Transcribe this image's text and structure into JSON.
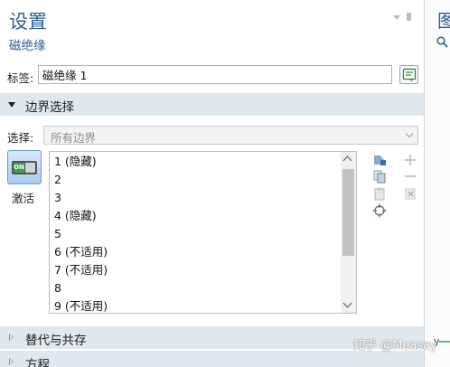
{
  "panel": {
    "title": "设置",
    "subtitle": "磁绝缘"
  },
  "label_field": {
    "label": "标签:",
    "value": "磁绝缘 1"
  },
  "boundary_section": {
    "title": "边界选择",
    "selection_label": "选择:",
    "selection_value": "所有边界",
    "toggle_on_text": "ON",
    "toggle_label": "激活",
    "items": [
      "1 (隐藏)",
      "2",
      "3",
      "4 (隐藏)",
      "5",
      "6 (不适用)",
      "7 (不适用)",
      "8",
      "9 (不适用)"
    ]
  },
  "sections": {
    "override": "替代与共存",
    "equation": "方程"
  },
  "right_panel": {
    "title": "图",
    "axis_label": "y"
  },
  "watermark": "知乎 @Measay",
  "colors": {
    "title_blue": "#2f5e95",
    "section_bg": "#dfe7ef",
    "toggle_green": "#3aa34a"
  },
  "icons": [
    "label-edit-icon",
    "add-selection-icon",
    "copy-selection-icon",
    "paste-selection-icon",
    "locate-icon",
    "add-icon",
    "remove-icon",
    "clear-selection-icon",
    "zoom-icon"
  ]
}
